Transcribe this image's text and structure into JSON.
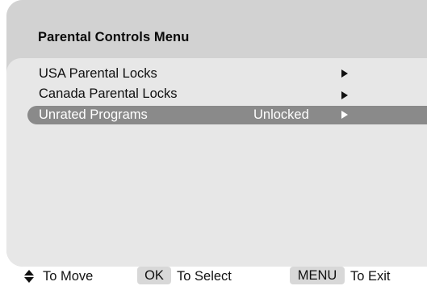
{
  "menu": {
    "title": "Parental Controls Menu",
    "items": [
      {
        "label": "USA Parental Locks",
        "value": "",
        "selected": false
      },
      {
        "label": "Canada Parental Locks",
        "value": "",
        "selected": false
      },
      {
        "label": "Unrated Programs",
        "value": "Unlocked",
        "selected": true
      }
    ]
  },
  "footer": {
    "move_label": "To Move",
    "ok_key": "OK",
    "select_label": "To Select",
    "menu_key": "MENU",
    "exit_label": "To Exit"
  },
  "icons": {
    "move": "up-down-arrows-icon",
    "submenu": "right-triangle-icon"
  },
  "colors": {
    "frame": "#d2d2d2",
    "panel": "#e7e7e7",
    "highlight": "#8a8a8a",
    "key_bg": "#d8d8d8"
  }
}
